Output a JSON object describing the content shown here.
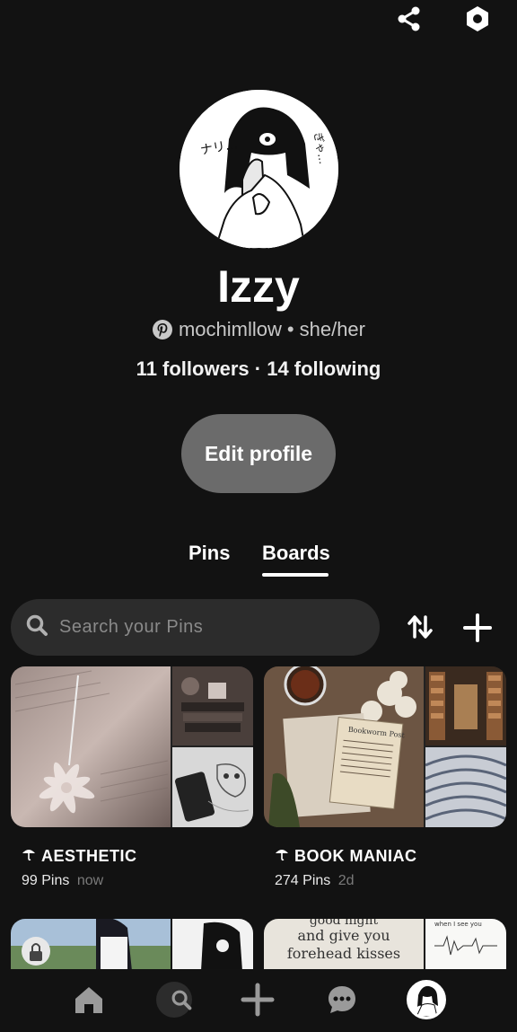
{
  "topbar": {
    "icons": [
      "share-icon",
      "settings-hexagon-icon"
    ]
  },
  "profile": {
    "name": "Izzy",
    "handle": "mochimllow",
    "separator": "•",
    "pronouns": "she/her",
    "followers_text": "11 followers",
    "following_text": "14 following",
    "follow_separator": "·",
    "edit_label": "Edit profile"
  },
  "tabs": [
    {
      "label": "Pins",
      "active": false
    },
    {
      "label": "Boards",
      "active": true
    }
  ],
  "search": {
    "placeholder": "Search your Pins"
  },
  "boards": [
    {
      "title": "AESTHETIC",
      "pins": "99 Pins",
      "time": "now",
      "icon": "umbrella-icon"
    },
    {
      "title": "BOOK MANIAC",
      "pins": "274 Pins",
      "time": "2d",
      "icon": "umbrella-icon"
    }
  ],
  "partial_boards": [
    {
      "locked": true
    },
    {
      "text_lines": [
        "good night",
        "and give you",
        "forehead kisses"
      ],
      "note": "when I see you"
    }
  ],
  "bottom_nav": [
    "home-icon",
    "search-icon",
    "plus-icon",
    "chat-icon",
    "profile-avatar"
  ],
  "colors": {
    "background": "#121212",
    "button": "#6b6b6b",
    "search_bg": "#2c2c2c"
  }
}
